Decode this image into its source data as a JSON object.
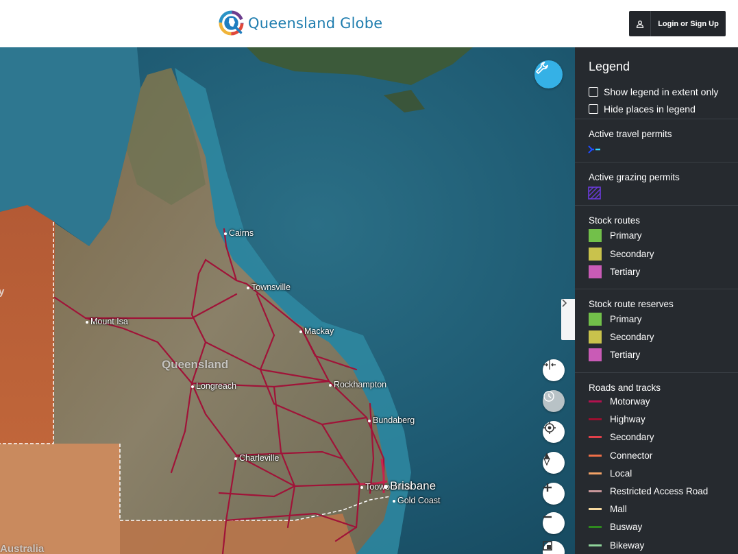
{
  "header": {
    "logo_text": "Queensland Globe",
    "login_label": "Login or Sign Up"
  },
  "map": {
    "places": [
      {
        "name": "Cairns",
        "major": false
      },
      {
        "name": "Townsville",
        "major": false
      },
      {
        "name": "Mount Isa",
        "major": false
      },
      {
        "name": "Mackay",
        "major": false
      },
      {
        "name": "Queensland",
        "major": false
      },
      {
        "name": "Longreach",
        "major": false
      },
      {
        "name": "Rockhampton",
        "major": false
      },
      {
        "name": "Bundaberg",
        "major": false
      },
      {
        "name": "Charleville",
        "major": false
      },
      {
        "name": "Toowoomba",
        "major": false
      },
      {
        "name": "Brisbane",
        "major": true
      },
      {
        "name": "Gold Coast",
        "major": false
      },
      {
        "name": "Australia",
        "major": false
      }
    ],
    "edge_label": "y",
    "controls": [
      "compare-icon",
      "history-icon",
      "locate-icon",
      "compass-icon",
      "zoom-in-icon",
      "zoom-out-icon",
      "screen-icon"
    ]
  },
  "legend": {
    "title": "Legend",
    "options": [
      {
        "label": "Show legend in extent only",
        "checked": false
      },
      {
        "label": "Hide places in legend",
        "checked": false
      }
    ],
    "travel": {
      "title": "Active travel permits"
    },
    "grazing": {
      "title": "Active grazing permits"
    },
    "stock_routes": {
      "title": "Stock routes",
      "items": [
        {
          "label": "Primary",
          "color": "#72c04a"
        },
        {
          "label": "Secondary",
          "color": "#c9c24c"
        },
        {
          "label": "Tertiary",
          "color": "#c95bb6"
        }
      ]
    },
    "stock_reserves": {
      "title": "Stock route reserves",
      "items": [
        {
          "label": "Primary",
          "color": "#72c04a"
        },
        {
          "label": "Secondary",
          "color": "#c9c24c"
        },
        {
          "label": "Tertiary",
          "color": "#c95bb6"
        }
      ]
    },
    "roads": {
      "title": "Roads and tracks",
      "items": [
        {
          "label": "Motorway",
          "color": "#b3124f"
        },
        {
          "label": "Highway",
          "color": "#9c0f2f"
        },
        {
          "label": "Secondary",
          "color": "#e0404a"
        },
        {
          "label": "Connector",
          "color": "#ef6f47"
        },
        {
          "label": "Local",
          "color": "#f2a267"
        },
        {
          "label": "Restricted Access Road",
          "color": "#c9979a"
        },
        {
          "label": "Mall",
          "color": "#f6d9a0"
        },
        {
          "label": "Busway",
          "color": "#2e8a1e"
        },
        {
          "label": "Bikeway",
          "color": "#8fd39a"
        }
      ]
    }
  }
}
